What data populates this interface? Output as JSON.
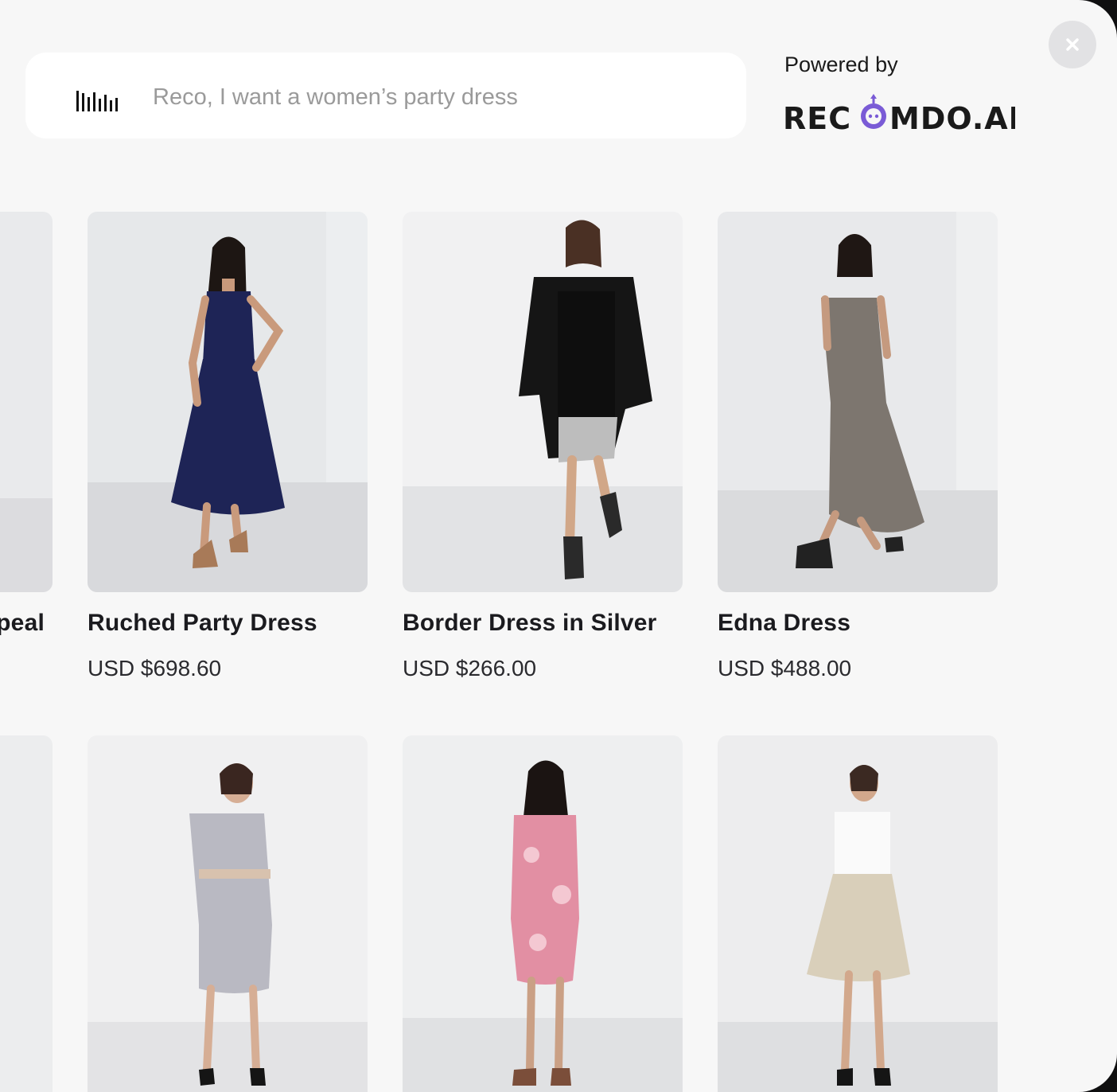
{
  "search": {
    "placeholder": "Reco, I want a women’s party dress"
  },
  "branding": {
    "powered_by": "Powered by",
    "logo_text": "RECOMDO.AI",
    "logo_accent_color": "#7a5bd6"
  },
  "icons": {
    "voice": "voice-waveform-icon",
    "close": "close-icon"
  },
  "products": [
    {
      "name": "peal",
      "price": ""
    },
    {
      "name": "Ruched Party Dress",
      "price": "USD $698.60",
      "dress_color": "#1e2456"
    },
    {
      "name": "Border Dress in Silver",
      "price": "USD $266.00",
      "dress_color": "#141414"
    },
    {
      "name": "Edna Dress",
      "price": "USD $488.00",
      "dress_color": "#7d766f"
    },
    {
      "name": "",
      "price": ""
    },
    {
      "name": "",
      "price": "",
      "dress_color": "#b9b9c2"
    },
    {
      "name": "",
      "price": "",
      "dress_color": "#e28fa3"
    },
    {
      "name": "",
      "price": "",
      "dress_color": "#d9cfba"
    }
  ]
}
